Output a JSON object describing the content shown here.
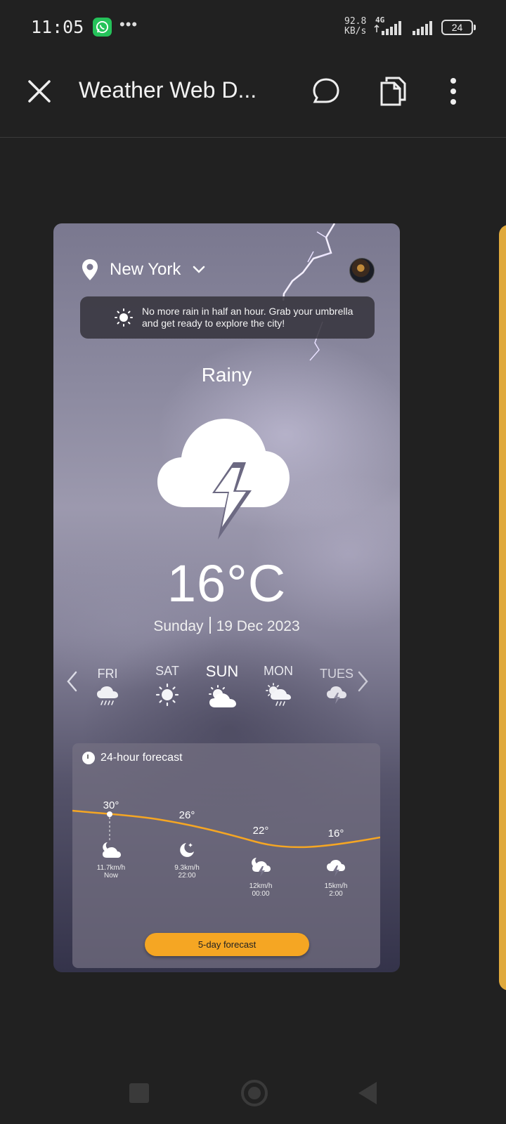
{
  "status_bar": {
    "time": "11:05",
    "dots": "•••",
    "speed_value": "92.8",
    "speed_unit": "KB/s",
    "network": "4G",
    "battery": "24"
  },
  "app_bar": {
    "title": "Weather Web D..."
  },
  "weather_card": {
    "location": "New York",
    "notice": "No more rain in half an hour. Grab your umbrella and get ready to explore the city!",
    "condition": "Rainy",
    "temperature": "16°C",
    "day": "Sunday",
    "date": "19 Dec 2023",
    "days": [
      {
        "name": "FRI",
        "icon": "rain-cloud-icon"
      },
      {
        "name": "SAT",
        "icon": "sun-icon"
      },
      {
        "name": "SUN",
        "icon": "partly-cloudy-icon",
        "active": true
      },
      {
        "name": "MON",
        "icon": "sun-rain-icon"
      },
      {
        "name": "TUES",
        "icon": "storm-cloud-icon"
      }
    ],
    "forecast": {
      "title": "24-hour forecast",
      "hours": [
        {
          "temp": "30°",
          "wind": "11.7km/h",
          "time": "Now",
          "icon": "night-cloud-icon"
        },
        {
          "temp": "26°",
          "wind": "9.3km/h",
          "time": "22:00",
          "icon": "moon-icon"
        },
        {
          "temp": "22°",
          "wind": "12km/h",
          "time": "00:00",
          "icon": "night-storm-icon"
        },
        {
          "temp": "16°",
          "wind": "15km/h",
          "time": "2:00",
          "icon": "storm-cloud-icon"
        }
      ],
      "button": "5-day forecast"
    }
  },
  "colors": {
    "background": "#212121",
    "accent": "#f5a623",
    "side_strip": "#e0a93c"
  }
}
